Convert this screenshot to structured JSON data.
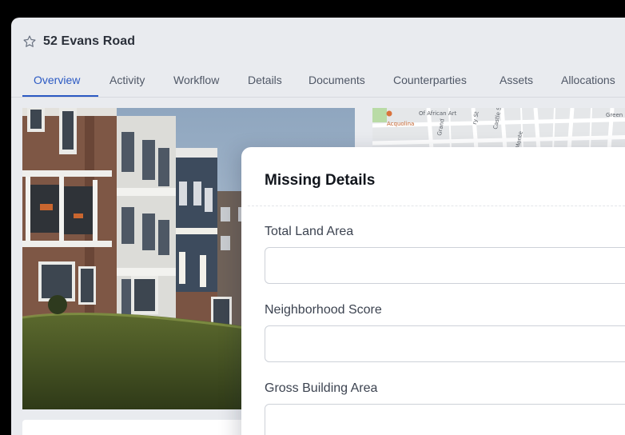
{
  "header": {
    "title": "52 Evans Road",
    "favorite_icon": "star-icon"
  },
  "tabs": [
    {
      "label": "Overview",
      "active": true
    },
    {
      "label": "Activity",
      "active": false
    },
    {
      "label": "Workflow",
      "active": false
    },
    {
      "label": "Details",
      "active": false
    },
    {
      "label": "Documents",
      "active": false
    },
    {
      "label": "Counterparties",
      "active": false
    },
    {
      "label": "Assets",
      "active": false
    },
    {
      "label": "Allocations",
      "active": false
    }
  ],
  "map": {
    "labels": [
      "Of African Art",
      "Acquolina",
      "Green",
      "Grand",
      "Castle St",
      "Monte",
      "ry St"
    ]
  },
  "modal": {
    "title": "Missing Details",
    "fields": [
      {
        "label": "Total Land Area",
        "value": "",
        "placeholder": ""
      },
      {
        "label": "Neighborhood Score",
        "value": "",
        "placeholder": ""
      },
      {
        "label": "Gross Building Area",
        "value": "",
        "placeholder": ""
      }
    ]
  },
  "colors": {
    "accent": "#2b59c3",
    "background": "#e9ebef",
    "surface": "#ffffff",
    "text": "#2b303a"
  }
}
